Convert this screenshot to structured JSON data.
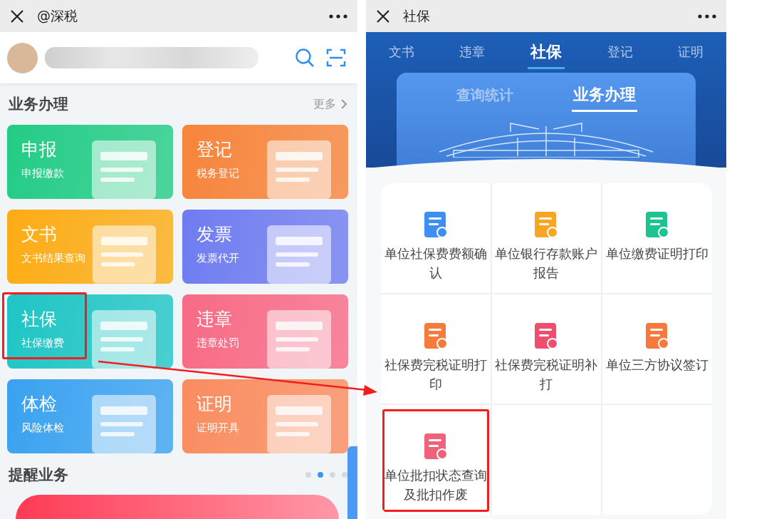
{
  "left": {
    "title": "@深税",
    "section": {
      "title": "业务办理",
      "more": "更多"
    },
    "cards": [
      {
        "title": "申报",
        "subtitle": "申报缴款",
        "color": "#22cc85",
        "highlighted": false
      },
      {
        "title": "登记",
        "subtitle": "税务登记",
        "color": "#f7843a",
        "highlighted": false
      },
      {
        "title": "文书",
        "subtitle": "文书结果查询",
        "color": "#fdac14",
        "highlighted": false
      },
      {
        "title": "发票",
        "subtitle": "发票代开",
        "color": "#6f7cf0",
        "highlighted": false
      },
      {
        "title": "社保",
        "subtitle": "社保缴费",
        "color": "#1fc5c5",
        "highlighted": true
      },
      {
        "title": "违章",
        "subtitle": "违章处罚",
        "color": "#f86a85",
        "highlighted": false
      },
      {
        "title": "体检",
        "subtitle": "风险体检",
        "color": "#3aa2f0",
        "highlighted": false
      },
      {
        "title": "证明",
        "subtitle": "证明开具",
        "color": "#fa8c5f",
        "highlighted": false
      }
    ],
    "reminder": {
      "title": "提醒业务",
      "dots": [
        {
          "selected": false
        },
        {
          "selected": true
        },
        {
          "selected": false
        },
        {
          "selected": false
        }
      ]
    }
  },
  "right": {
    "title": "社保",
    "tabs": [
      {
        "label": "文书",
        "selected": false
      },
      {
        "label": "违章",
        "selected": false
      },
      {
        "label": "社保",
        "selected": true
      },
      {
        "label": "登记",
        "selected": false
      },
      {
        "label": "证明",
        "selected": false
      }
    ],
    "subtabs": [
      {
        "label": "查询统计",
        "selected": false
      },
      {
        "label": "业务办理",
        "selected": true
      }
    ],
    "items": [
      {
        "label": "单位社保费费额确认",
        "color": "#3d8ff2",
        "highlighted": false
      },
      {
        "label": "单位银行存款账户报告",
        "color": "#f6a623",
        "highlighted": false
      },
      {
        "label": "单位缴费证明打印",
        "color": "#1bc491",
        "highlighted": false
      },
      {
        "label": "社保费完税证明打印",
        "color": "#f57b3c",
        "highlighted": false
      },
      {
        "label": "社保费完税证明补打",
        "color": "#f04e6e",
        "highlighted": false
      },
      {
        "label": "单位三方协议签订",
        "color": "#f7793d",
        "highlighted": false
      },
      {
        "label": "单位批扣状态查询及批扣作废",
        "color": "#f0627a",
        "highlighted": true
      }
    ]
  }
}
